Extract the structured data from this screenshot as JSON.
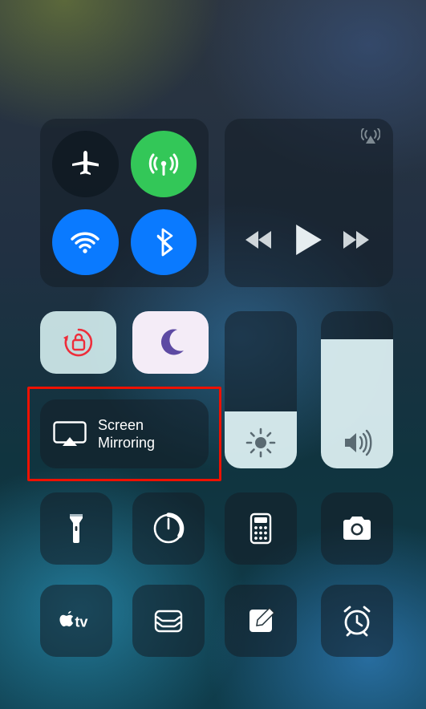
{
  "connectivity": {
    "airplane_mode": {
      "enabled": false,
      "icon": "airplane-icon"
    },
    "cellular": {
      "enabled": true,
      "color": "#33c758",
      "icon": "cellular-icon"
    },
    "wifi": {
      "enabled": true,
      "color": "#0a7aff",
      "icon": "wifi-icon"
    },
    "bluetooth": {
      "enabled": true,
      "color": "#0a7aff",
      "icon": "bluetooth-icon"
    }
  },
  "media": {
    "airplay_audio_icon": "airplay-audio-icon",
    "controls": {
      "prev": "rewind-icon",
      "play": "play-icon",
      "next": "fastforward-icon"
    }
  },
  "orientation_lock": {
    "enabled": true,
    "icon": "orientation-lock-icon"
  },
  "do_not_disturb": {
    "enabled": true,
    "icon": "moon-icon"
  },
  "screen_mirroring": {
    "icon": "screen-mirroring-icon",
    "label_line1": "Screen",
    "label_line2": "Mirroring",
    "highlighted": true,
    "highlight_color": "#ee1100"
  },
  "brightness": {
    "value_percent": 36,
    "icon": "brightness-icon"
  },
  "volume": {
    "value_percent": 82,
    "icon": "volume-icon"
  },
  "shortcuts": [
    {
      "name": "flashlight",
      "icon": "flashlight-icon"
    },
    {
      "name": "timer",
      "icon": "timer-icon"
    },
    {
      "name": "calculator",
      "icon": "calculator-icon"
    },
    {
      "name": "camera",
      "icon": "camera-icon"
    },
    {
      "name": "apple-tv",
      "icon": "apple-tv-icon",
      "label": "tv"
    },
    {
      "name": "wallet",
      "icon": "wallet-icon"
    },
    {
      "name": "notes",
      "icon": "notes-icon"
    },
    {
      "name": "alarm",
      "icon": "alarm-icon"
    }
  ]
}
